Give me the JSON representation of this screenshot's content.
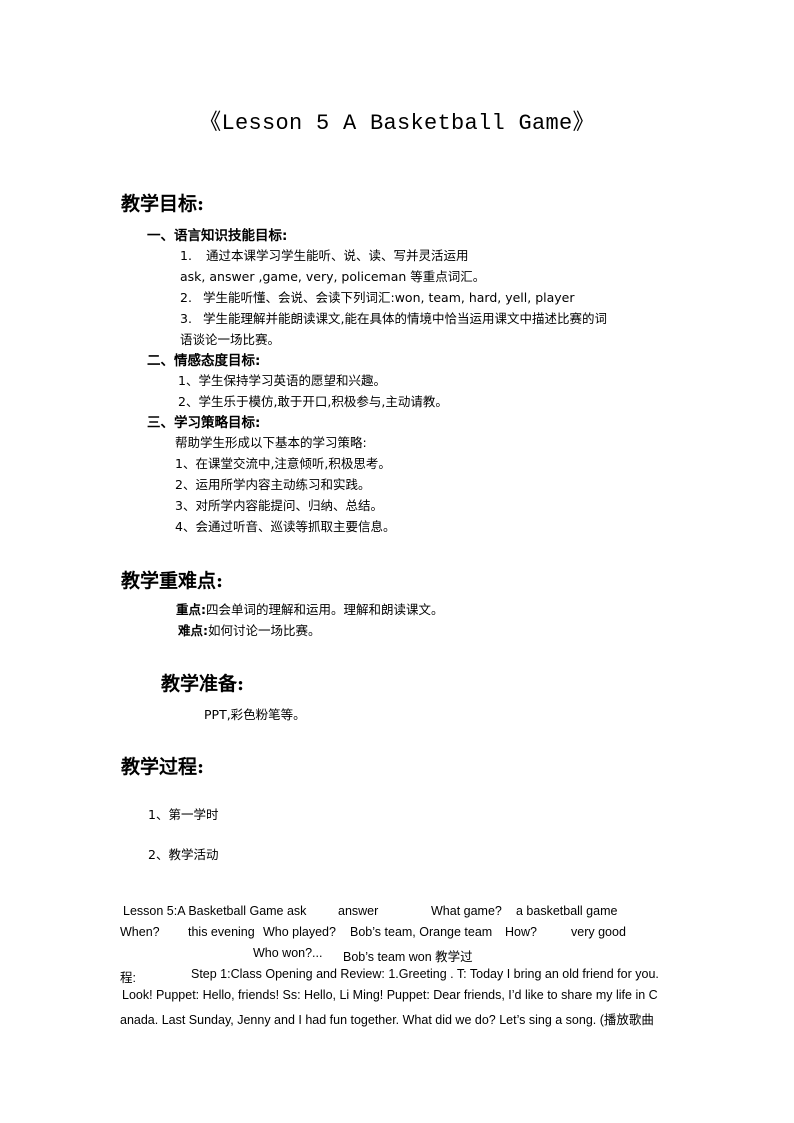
{
  "title": "《Lesson 5 A Basketball Game》",
  "objectives": {
    "heading": "教学目标:",
    "sec1": {
      "heading": "一、语言知识技能目标:",
      "item1_num": "1.",
      "item1_text": "通过本课学习学生能听、说、读、写并灵活运用",
      "item1_cont": "ask, answer ,game, very, policeman 等重点词汇。",
      "item2_num": "2.",
      "item2_text": "学生能听懂、会说、会读下列词汇:won, team, hard, yell, player",
      "item3_num": "3.",
      "item3_text": "学生能理解并能朗读课文,能在具体的情境中恰当运用课文中描述比赛的词",
      "item3_cont": "语谈论一场比赛。"
    },
    "sec2": {
      "heading": "二、情感态度目标:",
      "items": [
        "1、学生保持学习英语的愿望和兴趣。",
        "2、学生乐于模仿,敢于开口,积极参与,主动请教。"
      ]
    },
    "sec3": {
      "heading": "三、学习策略目标:",
      "intro": "帮助学生形成以下基本的学习策略:",
      "items": [
        "1、在课堂交流中,注意倾听,积极思考。",
        "2、运用所学内容主动练习和实践。",
        "3、对所学内容能提问、归纳、总结。",
        "4、会通过听音、巡读等抓取主要信息。"
      ]
    }
  },
  "key_points": {
    "heading": "教学重难点:",
    "focus_label": "重点:",
    "focus_text": "四会单词的理解和运用。理解和朗读课文。",
    "difficulty_label": "难点:",
    "difficulty_text": "如何讨论一场比赛。"
  },
  "preparation": {
    "heading": "教学准备:",
    "text": "PPT,彩色粉笔等。"
  },
  "process": {
    "heading": "教学过程:",
    "items": [
      "1、第一学时",
      "2、教学活动"
    ]
  },
  "body_lines": [
    "Lesson 5:A Basketball Game ask",
    "answer",
    "What game?",
    "a basketball game",
    "When?",
    "this evening",
    "Who  played?",
    "Bob’s team, Orange team",
    "How?",
    "very good",
    "Who won?...",
    "Bob’s team won 教学过",
    "程:",
    "Step 1:Class Opening and Review:  1.Greeting . T: Today I bring an old  friend for you.",
    "Look! Puppet: Hello, friends! Ss: Hello, Li Ming! Puppet: Dear friends, I’d like to share my life in C",
    "anada. Last Sunday, Jenny and I had fun together. What did we do?  Let’s sing a song. (播放歌曲"
  ]
}
